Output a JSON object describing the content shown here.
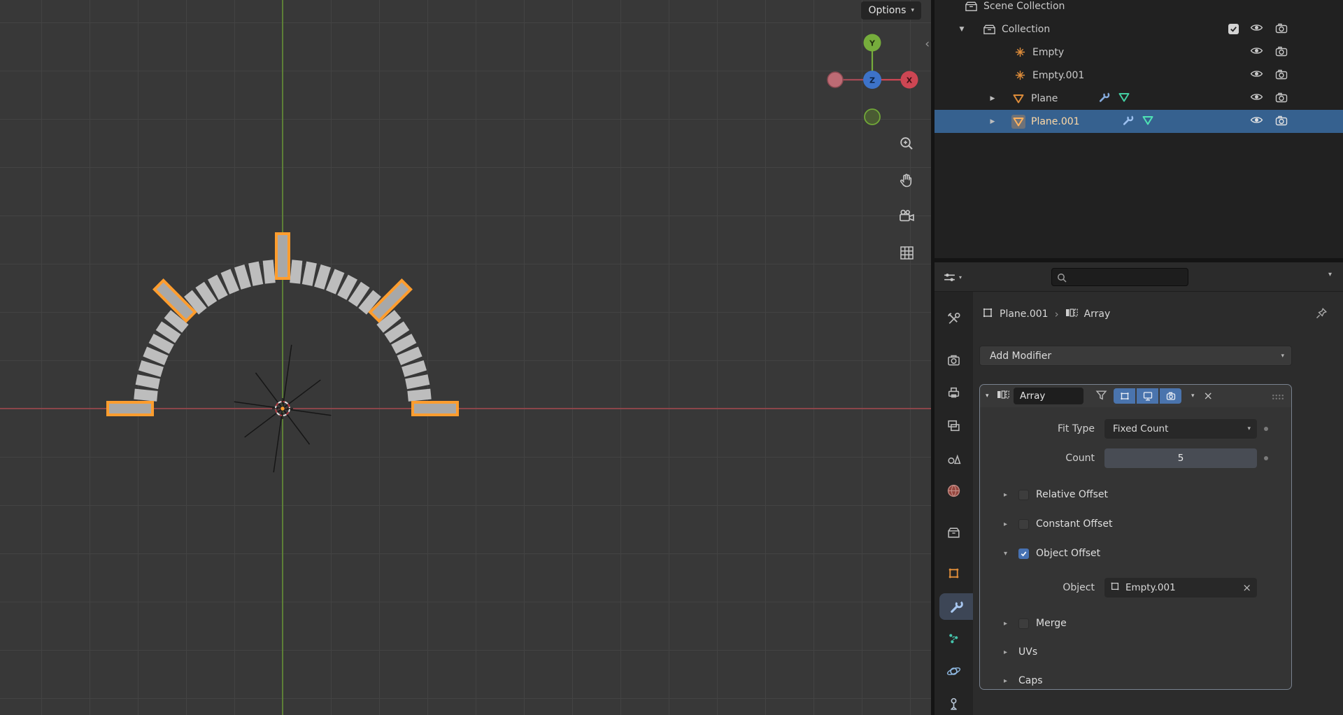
{
  "icons": {
    "chevron_down": "▾",
    "tri_down": "▼",
    "tri_right": "▶",
    "sec_closed": "▸",
    "sec_open": "▾",
    "crumb_sep": "›",
    "close": "×",
    "collapse_left": "‹"
  },
  "viewport": {
    "options_button": "Options",
    "gizmo": {
      "x_label": "X",
      "y_label": "Y",
      "z_label": "Z"
    },
    "scene": {
      "selected_plane_angles_deg": [
        0,
        45,
        90,
        135,
        180
      ],
      "ticks_between_selected": 7,
      "colors": {
        "instance_fill": "#bdbdbd",
        "selected_fill": "#a8a8a8",
        "selected_outline": "#ff9d2e",
        "axis_x_red": "#a5484f",
        "axis_y_green": "#699a34"
      }
    }
  },
  "outliner": {
    "rows": [
      {
        "label": "Scene Collection"
      },
      {
        "label": "Collection"
      },
      {
        "label": "Empty"
      },
      {
        "label": "Empty.001"
      },
      {
        "label": "Plane"
      },
      {
        "label": "Plane.001"
      }
    ]
  },
  "properties": {
    "search_value": "",
    "search_placeholder": "",
    "breadcrumb": {
      "object": "Plane.001",
      "modifier": "Array"
    },
    "add_modifier_label": "Add Modifier",
    "modifier": {
      "name": "Array",
      "fit_type_label": "Fit Type",
      "fit_type_value": "Fixed Count",
      "count_label": "Count",
      "count_value": "5",
      "relative_offset_label": "Relative Offset",
      "constant_offset_label": "Constant Offset",
      "object_offset_label": "Object Offset",
      "object_label": "Object",
      "object_value": "Empty.001",
      "merge_label": "Merge",
      "uvs_label": "UVs",
      "caps_label": "Caps"
    }
  }
}
